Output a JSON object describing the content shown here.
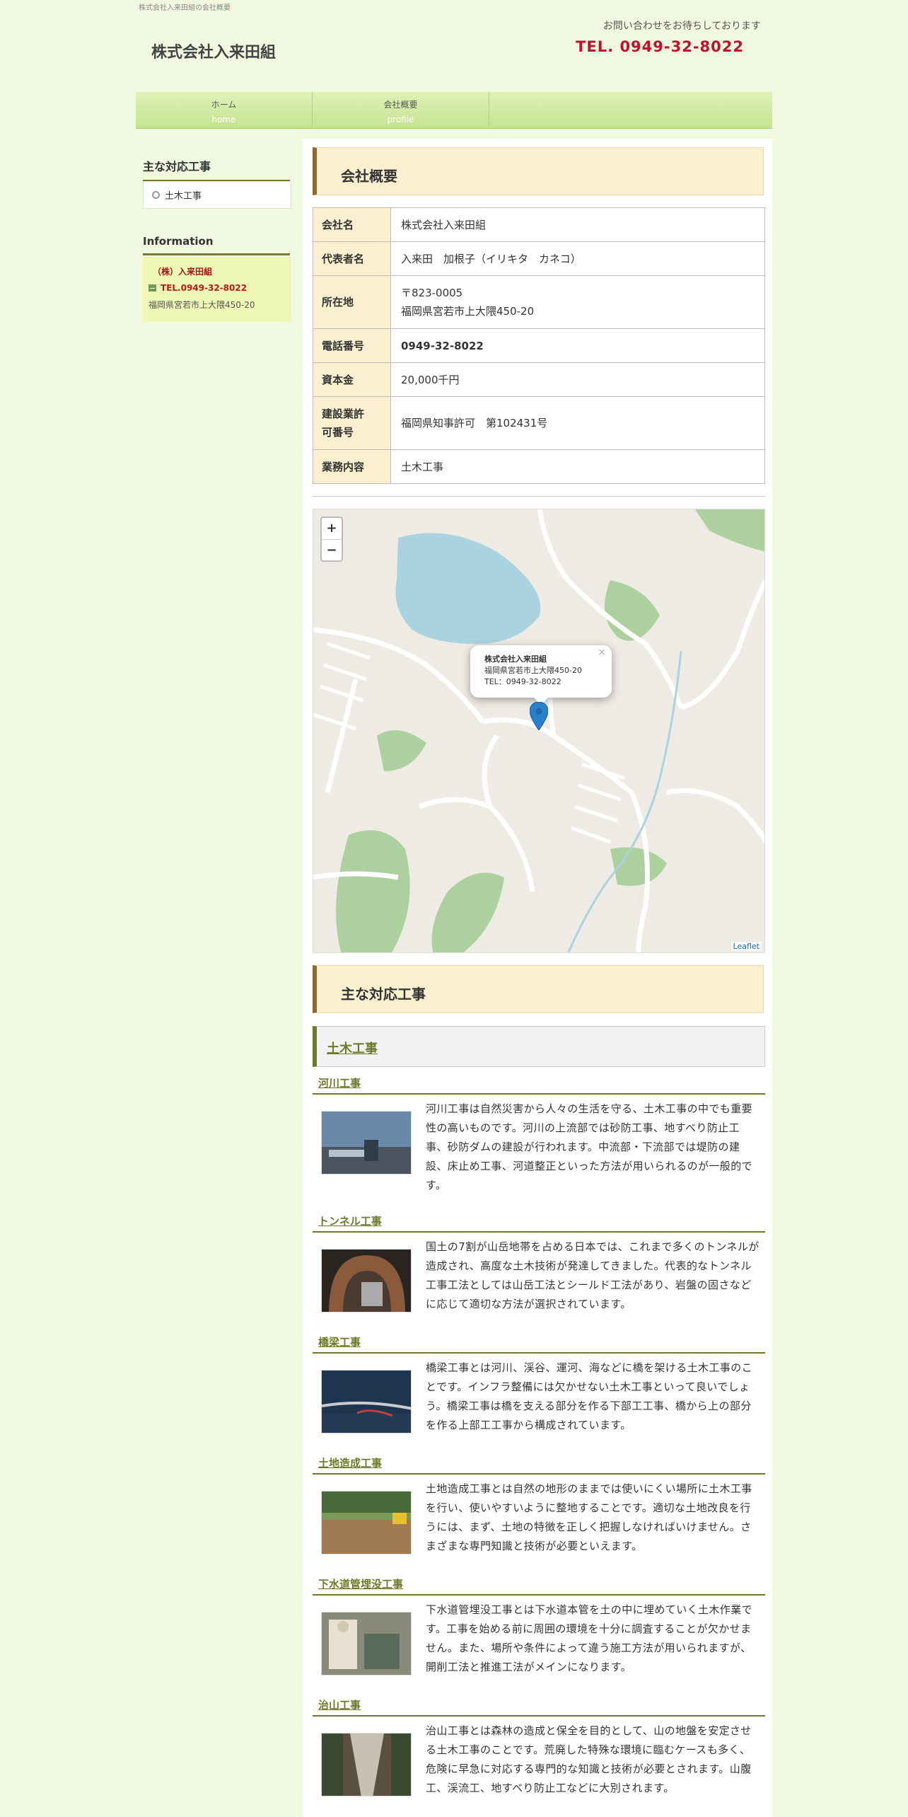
{
  "header": {
    "tagline": "株式会社入来田組の会社概要",
    "site_title": "株式会社入来田組",
    "contact_message": "お問い合わせをお待ちしております",
    "contact_tel": "TEL. 0949-32-8022"
  },
  "nav": [
    {
      "jp": "ホーム",
      "en": "home"
    },
    {
      "jp": "会社概要",
      "en": "profile"
    }
  ],
  "sidebar": {
    "works_heading": "主な対応工事",
    "works_items": [
      "土木工事"
    ],
    "info_heading": "Information",
    "info_name": "（株）入来田組",
    "info_tel": "TEL.0949-32-8022",
    "info_address": "福岡県宮若市上大隈450-20"
  },
  "main": {
    "profile_heading": "会社概要",
    "table": [
      {
        "label": "会社名",
        "value": "株式会社入来田組"
      },
      {
        "label": "代表者名",
        "value": "入来田　加根子（イリキタ　カネコ）"
      },
      {
        "label": "所在地",
        "value": "〒823-0005",
        "value2": "福岡県宮若市上大隈450-20"
      },
      {
        "label": "電話番号",
        "value": "0949-32-8022"
      },
      {
        "label": "資本金",
        "value": "20,000千円"
      },
      {
        "label": "建設業許",
        "label2": "可番号",
        "value": "福岡県知事許可　第102431号"
      },
      {
        "label": "業務内容",
        "value": "土木工事"
      }
    ],
    "map": {
      "zoom_in": "+",
      "zoom_out": "−",
      "popup_close": "×",
      "popup_name": "株式会社入来田組",
      "popup_address": "福岡県宮若市上大隈450-20",
      "popup_tel": "TEL：0949-32-8022",
      "attribution": "Leaflet"
    },
    "works_heading": "主な対応工事",
    "category": "土木工事",
    "works": [
      {
        "title": "河川工事",
        "text": "河川工事は自然災害から人々の生活を守る、土木工事の中でも重要性の高いものです。河川の上流部では砂防工事、地すべり防止工事、砂防ダムの建設が行われます。中流部・下流部では堤防の建設、床止め工事、河道整正といった方法が用いられるのが一般的です。"
      },
      {
        "title": "トンネル工事",
        "text": "国土の7割が山岳地帯を占める日本では、これまで多くのトンネルが造成され、高度な土木技術が発達してきました。代表的なトンネル工事工法としては山岳工法とシールド工法があり、岩盤の固さなどに応じて適切な方法が選択されています。"
      },
      {
        "title": "橋梁工事",
        "text": "橋梁工事とは河川、渓谷、運河、海などに橋を架ける土木工事のことです。インフラ整備には欠かせない土木工事といって良いでしょう。橋梁工事は橋を支える部分を作る下部工工事、橋から上の部分を作る上部工工事から構成されています。"
      },
      {
        "title": "土地造成工事",
        "text": "土地造成工事とは自然の地形のままでは使いにくい場所に土木工事を行い、使いやすいように整地することです。適切な土地改良を行うには、まず、土地の特徴を正しく把握しなければいけません。さまざまな専門知識と技術が必要といえます。"
      },
      {
        "title": "下水道管埋没工事",
        "text": "下水道管埋没工事とは下水道本管を土の中に埋めていく土木作業です。工事を始める前に周囲の環境を十分に調査することが欠かせません。また、場所や条件によって違う施工方法が用いられますが、開削工法と推進工法がメインになります。"
      },
      {
        "title": "治山工事",
        "text": "治山工事とは森林の造成と保全を目的として、山の地盤を安定させる土木工事のことです。荒廃した特殊な環境に臨むケースも多く、危険に早急に対応する専門的な知識と技術が必要とされます。山腹工、渓流工、地すべり防止工などに大別されます。"
      }
    ]
  },
  "colors": {
    "background": "#f0f8e0",
    "accent_red": "#c0122c",
    "nav_green": "#c5e38f",
    "heading_bg": "#faf0d0",
    "link_olive": "#6b7b2a"
  }
}
